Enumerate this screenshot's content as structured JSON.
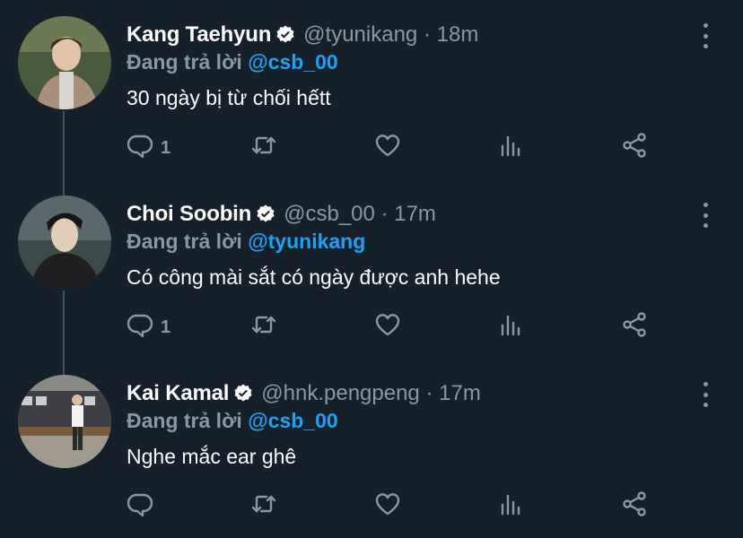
{
  "tweets": [
    {
      "name": "Kang Taehyun",
      "handle": "@tyunikang",
      "separator": "·",
      "time": "18m",
      "reply_prefix": "Đang trả lời",
      "reply_to": "@csb_00",
      "text": "30 ngày bị từ chối hếtt",
      "reply_count": "1",
      "avatar_icon": "user-avatar"
    },
    {
      "name": "Choi Soobin",
      "handle": "@csb_00",
      "separator": "·",
      "time": "17m",
      "reply_prefix": "Đang trả lời",
      "reply_to": "@tyunikang",
      "text": "Có công mài sắt có ngày được anh hehe",
      "reply_count": "1",
      "avatar_icon": "user-avatar"
    },
    {
      "name": "Kai Kamal",
      "handle": "@hnk.pengpeng",
      "separator": "·",
      "time": "17m",
      "reply_prefix": "Đang trả lời",
      "reply_to": "@csb_00",
      "text": "Nghe mắc ear ghê",
      "reply_count": "",
      "avatar_icon": "user-avatar"
    }
  ],
  "icons": [
    "reply-icon",
    "retweet-icon",
    "like-icon",
    "analytics-icon",
    "share-icon",
    "verified-icon",
    "more-icon"
  ],
  "colors": {
    "background": "#15202b",
    "secondary_text": "#8899a6",
    "accent": "#1da1f2",
    "thread_line": "#3d5466"
  }
}
